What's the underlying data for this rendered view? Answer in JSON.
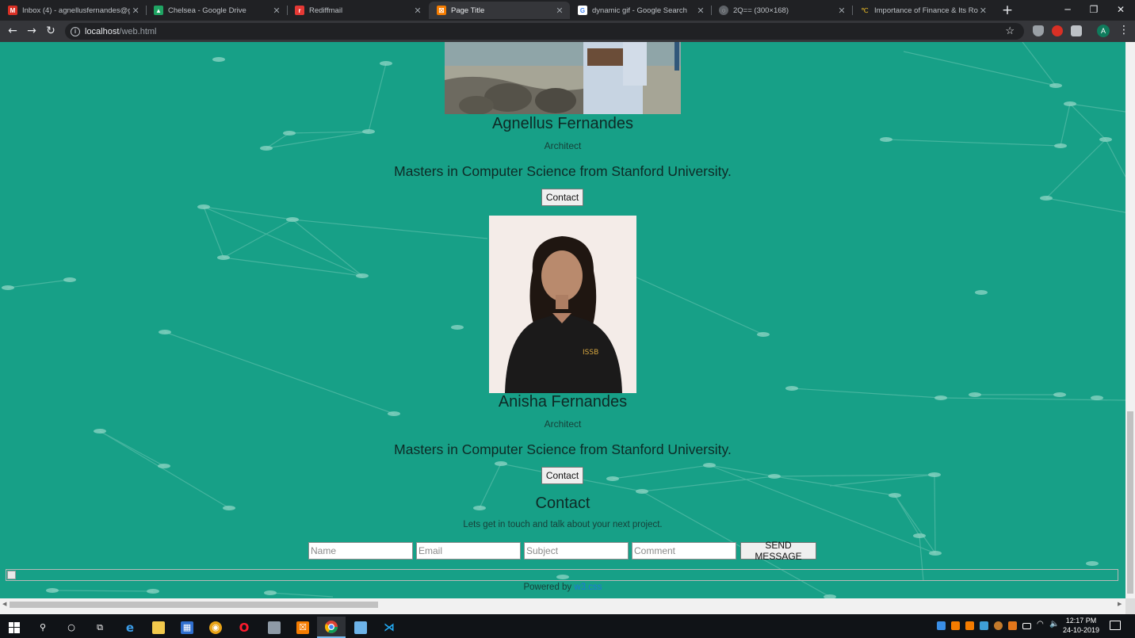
{
  "browser": {
    "tabs": [
      {
        "label": "Inbox (4) - agnellusfernandes@g",
        "icon": "gmail-icon",
        "color": "#d93025",
        "active": false
      },
      {
        "label": "Chelsea - Google Drive",
        "icon": "google-drive-icon",
        "color": "#1fa463",
        "active": false
      },
      {
        "label": "Rediffmail",
        "icon": "rediffmail-icon",
        "color": "#e53935",
        "active": false
      },
      {
        "label": "Page Title",
        "icon": "xampp-icon",
        "color": "#f57c00",
        "active": true
      },
      {
        "label": "dynamic gif - Google Search",
        "icon": "google-icon",
        "color": "#4285f4",
        "active": false
      },
      {
        "label": "2Q== (300×168)",
        "icon": "globe-icon",
        "color": "#9aa0a6",
        "active": false
      },
      {
        "label": "Importance of Finance & Its Role",
        "icon": "site-icon",
        "color": "#c9a227",
        "active": false
      }
    ],
    "new_tab_label": "+",
    "url_host": "localhost",
    "url_path": "/web.html",
    "avatar_letter": "A"
  },
  "page": {
    "people": [
      {
        "name": "Agnellus Fernandes",
        "role": "Architect",
        "education": "Masters in Computer Science from Stanford University.",
        "button": "Contact"
      },
      {
        "name": "Anisha Fernandes",
        "role": "Architect",
        "education": "Masters in Computer Science from Stanford University.",
        "button": "Contact"
      }
    ],
    "contact": {
      "title": "Contact",
      "subtitle": "Lets get in touch and talk about your next project.",
      "name_placeholder": "Name",
      "email_placeholder": "Email",
      "subject_placeholder": "Subject",
      "comment_placeholder": "Comment",
      "send_label": "SEND MESSAGE"
    },
    "footer": {
      "powered_text": "Powered by ",
      "powered_link": "w3.css"
    },
    "colors": {
      "background": "#17a087",
      "link": "#1f78d6"
    }
  },
  "taskbar": {
    "time": "12:17 PM",
    "date": "24-10-2019"
  }
}
